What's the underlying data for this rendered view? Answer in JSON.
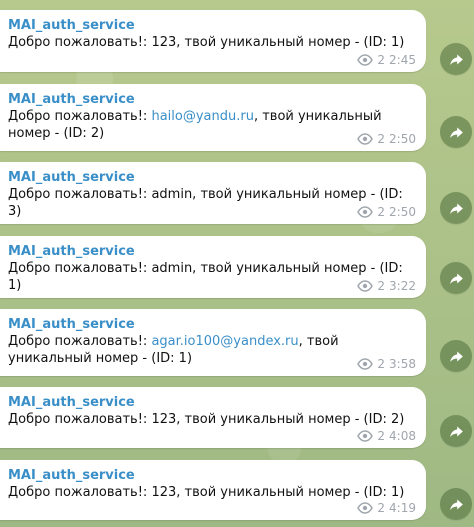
{
  "messages": [
    {
      "sender": "MAI_auth_service",
      "text_before": "Добро пожаловать!: 123, твой уникальный номер - (ID: 1)",
      "link": "",
      "text_after": "",
      "views": "2",
      "time": "2:45"
    },
    {
      "sender": "MAI_auth_service",
      "text_before": "Добро пожаловать!: ",
      "link": "hailo@yandu.ru",
      "text_after": ", твой уникальный номер - (ID: 2)",
      "views": "2",
      "time": "2:50"
    },
    {
      "sender": "MAI_auth_service",
      "text_before": "Добро пожаловать!: admin, твой уникальный номер - (ID: 3)",
      "link": "",
      "text_after": "",
      "views": "2",
      "time": "2:50"
    },
    {
      "sender": "MAI_auth_service",
      "text_before": "Добро пожаловать!: admin, твой уникальный номер - (ID: 1)",
      "link": "",
      "text_after": "",
      "views": "2",
      "time": "3:22"
    },
    {
      "sender": "MAI_auth_service",
      "text_before": "Добро пожаловать!: ",
      "link": "agar.io100@yandex.ru",
      "text_after": ", твой уникальный номер - (ID: 1)",
      "views": "2",
      "time": "3:58"
    },
    {
      "sender": "MAI_auth_service",
      "text_before": "Добро пожаловать!: 123, твой уникальный номер - (ID: 2)",
      "link": "",
      "text_after": "",
      "views": "2",
      "time": "4:08"
    },
    {
      "sender": "MAI_auth_service",
      "text_before": "Добро пожаловать!: 123, твой уникальный номер - (ID: 1)",
      "link": "",
      "text_after": "",
      "views": "2",
      "time": "4:19"
    }
  ],
  "icons": {
    "views": "eye-icon",
    "forward": "forward-icon"
  },
  "colors": {
    "background": "#a9bf8a",
    "bubble": "#ffffff",
    "accent": "#3a8fc8",
    "meta": "#a0a6ad",
    "forward": "#4e6e3a"
  }
}
